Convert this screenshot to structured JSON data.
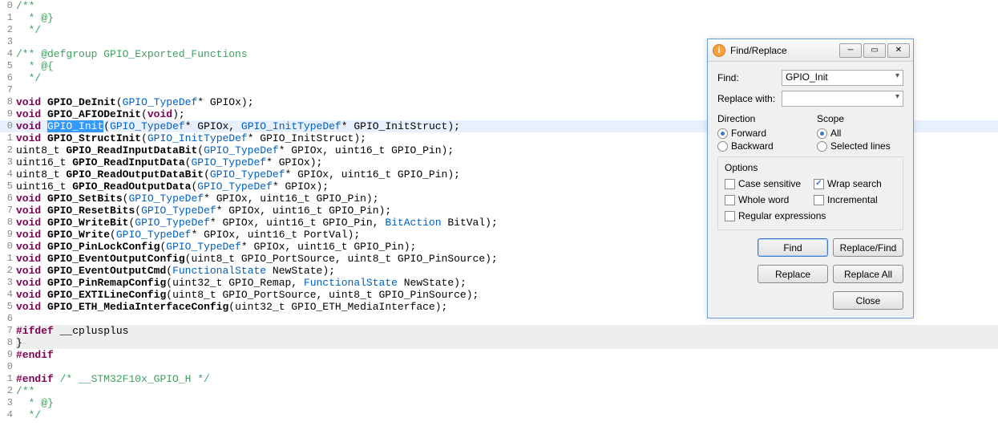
{
  "code": {
    "lines": [
      {
        "n": "0",
        "html": "<span class='c-comment'>/**</span>"
      },
      {
        "n": "1",
        "html": "&nbsp;<span class='c-comment'> * @}</span>"
      },
      {
        "n": "2",
        "html": "&nbsp;<span class='c-comment'> */</span>"
      },
      {
        "n": "3",
        "html": ""
      },
      {
        "n": "4",
        "html": "<span class='c-comment'>/** @defgroup GPIO_Exported_Functions</span>"
      },
      {
        "n": "5",
        "html": "&nbsp;<span class='c-comment'> * @{</span>"
      },
      {
        "n": "6",
        "html": "&nbsp;<span class='c-comment'> */</span>"
      },
      {
        "n": "7",
        "html": ""
      },
      {
        "n": "8",
        "html": "<span class='c-keyword'>void</span> <span class='c-func'>GPIO_DeInit</span>(<span class='c-type'>GPIO_TypeDef</span>* GPIOx);"
      },
      {
        "n": "9",
        "html": "<span class='c-keyword'>void</span> <span class='c-func'>GPIO_AFIODeInit</span>(<span class='c-keyword'>void</span>);"
      },
      {
        "n": "0",
        "hl": true,
        "html": "<span class='c-keyword'>void</span> <span class='sel'>GPIO_Init</span>(<span class='c-type'>GPIO_TypeDef</span>* GPIOx, <span class='c-type'>GPIO_InitTypeDef</span>* GPIO_InitStruct);"
      },
      {
        "n": "1",
        "html": "<span class='c-keyword'>void</span> <span class='c-func'>GPIO_StructInit</span>(<span class='c-type'>GPIO_InitTypeDef</span>* GPIO_InitStruct);"
      },
      {
        "n": "2",
        "html": "uint8_t <span class='c-func'>GPIO_ReadInputDataBit</span>(<span class='c-type'>GPIO_TypeDef</span>* GPIOx, uint16_t GPIO_Pin);"
      },
      {
        "n": "3",
        "html": "uint16_t <span class='c-func'>GPIO_ReadInputData</span>(<span class='c-type'>GPIO_TypeDef</span>* GPIOx);"
      },
      {
        "n": "4",
        "html": "uint8_t <span class='c-func'>GPIO_ReadOutputDataBit</span>(<span class='c-type'>GPIO_TypeDef</span>* GPIOx, uint16_t GPIO_Pin);"
      },
      {
        "n": "5",
        "html": "uint16_t <span class='c-func'>GPIO_ReadOutputData</span>(<span class='c-type'>GPIO_TypeDef</span>* GPIOx);"
      },
      {
        "n": "6",
        "html": "<span class='c-keyword'>void</span> <span class='c-func'>GPIO_SetBits</span>(<span class='c-type'>GPIO_TypeDef</span>* GPIOx, uint16_t GPIO_Pin);"
      },
      {
        "n": "7",
        "html": "<span class='c-keyword'>void</span> <span class='c-func'>GPIO_ResetBits</span>(<span class='c-type'>GPIO_TypeDef</span>* GPIOx, uint16_t GPIO_Pin);"
      },
      {
        "n": "8",
        "html": "<span class='c-keyword'>void</span> <span class='c-func'>GPIO_WriteBit</span>(<span class='c-type'>GPIO_TypeDef</span>* GPIOx, uint16_t GPIO_Pin, <span class='c-type'>BitAction</span> BitVal);"
      },
      {
        "n": "9",
        "html": "<span class='c-keyword'>void</span> <span class='c-func'>GPIO_Write</span>(<span class='c-type'>GPIO_TypeDef</span>* GPIOx, uint16_t PortVal);"
      },
      {
        "n": "0",
        "html": "<span class='c-keyword'>void</span> <span class='c-func'>GPIO_PinLockConfig</span>(<span class='c-type'>GPIO_TypeDef</span>* GPIOx, uint16_t GPIO_Pin);"
      },
      {
        "n": "1",
        "html": "<span class='c-keyword'>void</span> <span class='c-func'>GPIO_EventOutputConfig</span>(uint8_t GPIO_PortSource, uint8_t GPIO_PinSource);"
      },
      {
        "n": "2",
        "html": "<span class='c-keyword'>void</span> <span class='c-func'>GPIO_EventOutputCmd</span>(<span class='c-type'>FunctionalState</span> NewState);"
      },
      {
        "n": "3",
        "html": "<span class='c-keyword'>void</span> <span class='c-func'>GPIO_PinRemapConfig</span>(uint32_t GPIO_Remap, <span class='c-type'>FunctionalState</span> NewState);"
      },
      {
        "n": "4",
        "html": "<span class='c-keyword'>void</span> <span class='c-func'>GPIO_EXTILineConfig</span>(uint8_t GPIO_PortSource, uint8_t GPIO_PinSource);"
      },
      {
        "n": "5",
        "html": "<span class='c-keyword'>void</span> <span class='c-func'>GPIO_ETH_MediaInterfaceConfig</span>(uint32_t GPIO_ETH_MediaInterface);"
      },
      {
        "n": "6",
        "html": ""
      },
      {
        "n": "7",
        "html": "<span class='c-grayblock'><span class='c-preproc'>#ifdef</span> __cplusplus</span>"
      },
      {
        "n": "8",
        "html": "<span class='c-grayblock'>}</span>"
      },
      {
        "n": "9",
        "html": "<span class='c-preproc'>#endif</span>"
      },
      {
        "n": "0",
        "html": ""
      },
      {
        "n": "1",
        "html": "<span class='c-preproc'>#endif</span> <span class='c-comment'>/* __STM32F10x_GPIO_H */</span>"
      },
      {
        "n": "2",
        "html": "<span class='c-comment'>/**</span>"
      },
      {
        "n": "3",
        "html": "&nbsp;<span class='c-comment'> * @}</span>"
      },
      {
        "n": "4",
        "html": "&nbsp;<span class='c-comment'> */</span>"
      }
    ]
  },
  "dialog": {
    "title": "Find/Replace",
    "find_label": "Find:",
    "find_value": "GPIO_Init",
    "replace_label": "Replace with:",
    "replace_value": "",
    "direction_label": "Direction",
    "dir_forward": "Forward",
    "dir_backward": "Backward",
    "scope_label": "Scope",
    "scope_all": "All",
    "scope_selected": "Selected lines",
    "options_label": "Options",
    "opt_case": "Case sensitive",
    "opt_wrap": "Wrap search",
    "opt_whole": "Whole word",
    "opt_incr": "Incremental",
    "opt_regex": "Regular expressions",
    "btn_find": "Find",
    "btn_replace_find": "Replace/Find",
    "btn_replace": "Replace",
    "btn_replace_all": "Replace All",
    "btn_close": "Close"
  }
}
